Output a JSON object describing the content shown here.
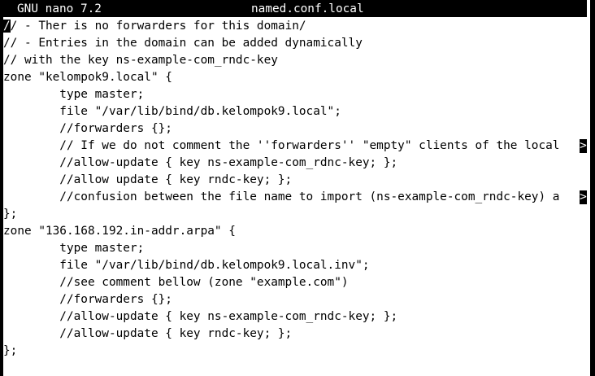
{
  "titlebar": {
    "app_name": "GNU nano 7.2",
    "file_name": "named.conf.local"
  },
  "editor": {
    "cursor_char": "/",
    "first_line_rest": "/ - Ther is no forwarders for this domain/",
    "overflow_marker": ">",
    "lines": [
      "// - Entries in the domain can be added dynamically",
      "// with the key ns-example-com_rndc-key",
      "zone \"kelompok9.local\" {",
      "        type master;",
      "        file \"/var/lib/bind/db.kelompok9.local\";",
      "        //forwarders {};",
      "        // If we do not comment the ''forwarders'' \"empty\" clients of the local",
      "        //allow-update { key ns-example-com_rdnc-key; };",
      "        //allow update { key rndc-key; };",
      "        //confusion between the file name to import (ns-example-com_rndc-key) a",
      "};",
      "zone \"136.168.192.in-addr.arpa\" {",
      "        type master;",
      "        file \"/var/lib/bind/db.kelompok9.local.inv\";",
      "        //see comment bellow (zone \"example.com\")",
      "        //forwarders {};",
      "        //allow-update { key ns-example-com_rndc-key; };",
      "        //allow-update { key rndc-key; };",
      "};"
    ]
  }
}
